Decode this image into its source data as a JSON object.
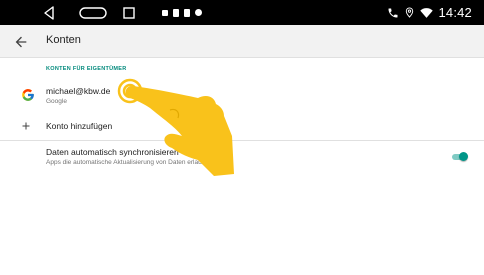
{
  "status_bar": {
    "time": "14:42",
    "icons": [
      "back-triangle-icon",
      "home-pill-icon",
      "recents-square-icon",
      "phone-icon",
      "location-icon",
      "wifi-icon"
    ]
  },
  "app_bar": {
    "title": "Konten"
  },
  "section": {
    "header": "KONTEN FÜR EIGENTÜMER"
  },
  "account": {
    "email": "michael@kbw.de",
    "provider": "Google"
  },
  "add_account": {
    "label": "Konto hinzufügen"
  },
  "sync": {
    "title": "Daten automatisch synchronisieren",
    "subtitle": "Apps die automatische Aktualisierung von Daten erlauben",
    "enabled": true
  },
  "colors": {
    "accent": "#009688",
    "section_header": "#00897b",
    "status_bar": "#000000",
    "app_bar": "#f2f2f2",
    "hand": "#f9c21b"
  }
}
